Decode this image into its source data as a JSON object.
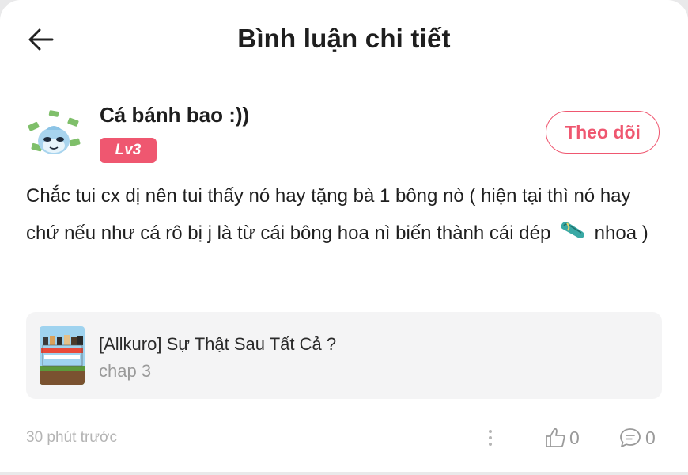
{
  "header": {
    "title": "Bình luận chi tiết",
    "back_icon": "arrow-left-icon"
  },
  "user": {
    "name": "Cá bánh bao :))",
    "level": "Lv3",
    "follow_label": "Theo dõi"
  },
  "comment": {
    "text_before": "Chắc tui cx dị nên tui thấy nó hay tặng bà 1 bông nò ( hiện tại thì nó hay chứ nếu như cá rô bị j là từ cái bông hoa nì biến thành cái dép",
    "emoji_icon": "sandal-icon",
    "text_after": "nhoa )"
  },
  "story": {
    "title": "[Allkuro] Sự Thật Sau Tất Cả ?",
    "chapter": "chap 3"
  },
  "footer": {
    "time": "30 phút trước",
    "like_count": "0",
    "reply_count": "0"
  },
  "colors": {
    "accent": "#ef5770",
    "muted": "#9a9a9a",
    "card_bg": "#f4f4f5"
  }
}
